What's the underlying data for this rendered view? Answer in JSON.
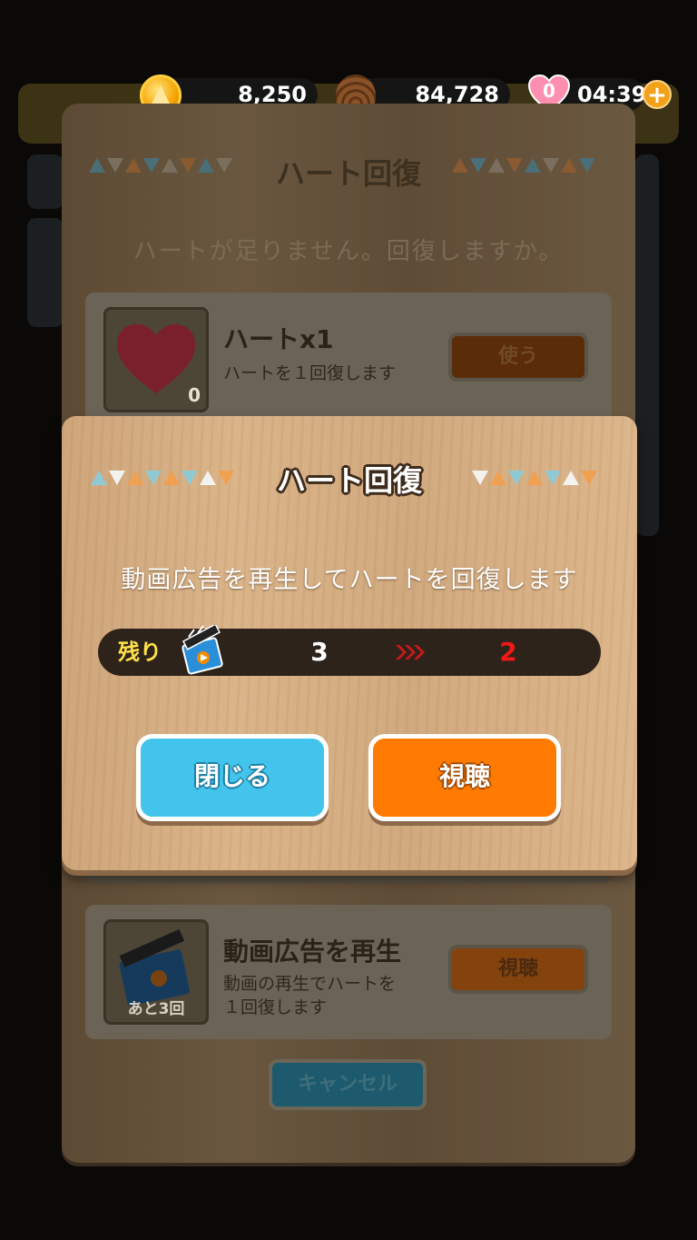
{
  "hud": {
    "coins": "8,250",
    "pinecones": "84,728",
    "hearts_count": "0",
    "timer": "04:39",
    "plus_label": "+"
  },
  "back_dialog": {
    "title": "ハート回復",
    "subtitle": "ハートが足りません。回復しますか。",
    "item_card": {
      "title": "ハートx1",
      "description": "ハートを１回復します",
      "count": "0",
      "button": "使う"
    },
    "video_card": {
      "title": "動画広告を再生",
      "description_line1": "動画の再生でハートを",
      "description_line2": "１回復します",
      "badge": "あと3回",
      "button": "視聴"
    },
    "cancel_button": "キャンセル"
  },
  "modal": {
    "title": "ハート回復",
    "message": "動画広告を再生してハートを回復します",
    "remaining_label": "残り",
    "remaining_current": "3",
    "remaining_after": "2",
    "close_button": "閉じる",
    "watch_button": "視聴"
  },
  "colors": {
    "close_button": "#43c4ec",
    "watch_button": "#ff7a00",
    "remaining_after": "#f01818",
    "remaining_label": "#ffe14a"
  },
  "icons": {
    "currency": "coin-icon",
    "secondary_currency": "pinecone-icon",
    "heart": "heart-icon",
    "add": "plus-icon",
    "video": "clapperboard-icon",
    "transition": "arrows-right-icon"
  }
}
